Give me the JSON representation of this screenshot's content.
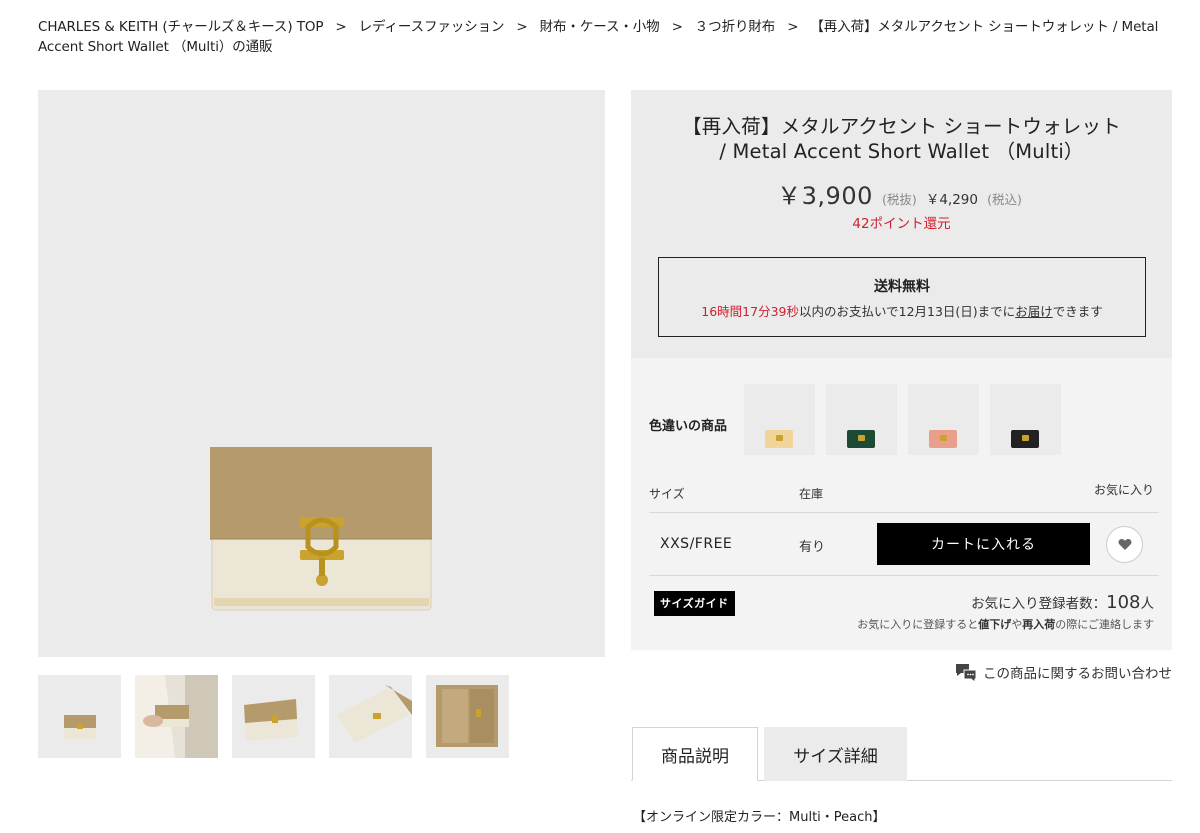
{
  "breadcrumb": [
    "CHARLES & KEITH (チャールズ＆キース) TOP",
    "レディースファッション",
    "財布・ケース・小物",
    "３つ折り財布",
    "【再入荷】メタルアクセント ショートウォレット / Metal Accent Short Wallet （Multi）の通販"
  ],
  "breadcrumb_separator": ">",
  "product": {
    "title_line1": "【再入荷】メタルアクセント ショートウォレット",
    "title_line2": "/ Metal Accent Short Wallet （Multi）",
    "price": "￥3,900",
    "price_tax_excluded_note": "(税抜)",
    "price_with_tax": "￥4,290",
    "price_tax_included_note": "(税込)",
    "points": "42ポイント還元"
  },
  "shipping": {
    "title": "送料無料",
    "countdown": "16時間17分39秒",
    "msg_part1": "以内のお支払いで12月13日(日)までに",
    "msg_link": "お届け",
    "msg_part2": "できます"
  },
  "colors": {
    "label": "色違いの商品",
    "swatch_colors": [
      "#f0d49a",
      "#1d4a35",
      "#e8a08a",
      "#222222"
    ],
    "swatch_bg": "#ebebeb"
  },
  "size_table": {
    "header_size": "サイズ",
    "header_stock": "在庫",
    "header_fav": "お気に入り",
    "size": "XXS/FREE",
    "stock": "有り",
    "cart_button": "カートに入れる",
    "size_guide": "サイズガイド",
    "fav_count_label": "お気に入り登録者数：",
    "fav_count": "108",
    "fav_count_unit": "人",
    "fav_note_1": "お気に入りに登録すると",
    "fav_note_b1": "値下げ",
    "fav_note_2": "や",
    "fav_note_b2": "再入荷",
    "fav_note_3": "の際にご連絡します"
  },
  "inquiry": "この商品に関するお問い合わせ",
  "tabs": [
    "商品説明",
    "サイズ詳細"
  ],
  "description_first_line": "【オンライン限定カラー：Multi・Peach】",
  "palette": {
    "accent_red": "#d0202f",
    "wallet_top": "#b59a6c",
    "wallet_bottom": "#ece6d6",
    "clasp_gold": "#c9a230"
  }
}
